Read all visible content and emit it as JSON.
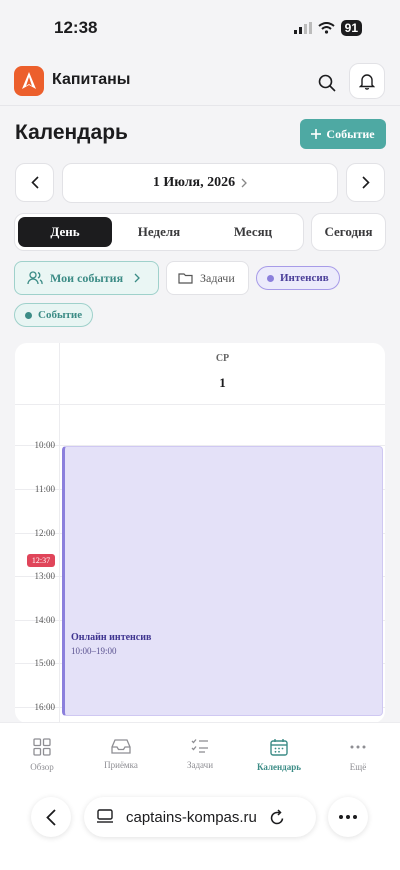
{
  "status": {
    "time": "12:38",
    "battery": "91"
  },
  "header": {
    "app_name": "Капитаны"
  },
  "page": {
    "title": "Календарь",
    "add_label": "Событие"
  },
  "date_nav": {
    "current": "1 Июля, 2026"
  },
  "view_tabs": [
    {
      "label": "День",
      "active": true
    },
    {
      "label": "Неделя",
      "active": false
    },
    {
      "label": "Месяц",
      "active": false
    }
  ],
  "today_label": "Сегодня",
  "filters": {
    "my_events": "Мои события",
    "tasks": "Задачи",
    "intensive": "Интенсив",
    "event": "Событие"
  },
  "calendar": {
    "day_of_week": "СР",
    "day_number": "1",
    "hours": [
      "10:00",
      "11:00",
      "12:00",
      "13:00",
      "14:00",
      "15:00",
      "16:00"
    ],
    "now_time": "12:37",
    "event": {
      "title": "Онлайн интенсив",
      "time": "10:00–19:00"
    }
  },
  "tabbar": [
    {
      "label": "Обзор",
      "icon": "grid-icon",
      "active": false
    },
    {
      "label": "Приёмка",
      "icon": "inbox-icon",
      "active": false
    },
    {
      "label": "Задачи",
      "icon": "checklist-icon",
      "active": false
    },
    {
      "label": "Календарь",
      "icon": "calendar-icon",
      "active": true
    },
    {
      "label": "Ещё",
      "icon": "more-icon",
      "active": false
    }
  ],
  "browser": {
    "url": "captains-kompas.ru"
  },
  "colors": {
    "accent": "#4ea9a3",
    "brand": "#ec5f2c",
    "intensive": "#8b7fdc",
    "now": "#e0455a"
  }
}
